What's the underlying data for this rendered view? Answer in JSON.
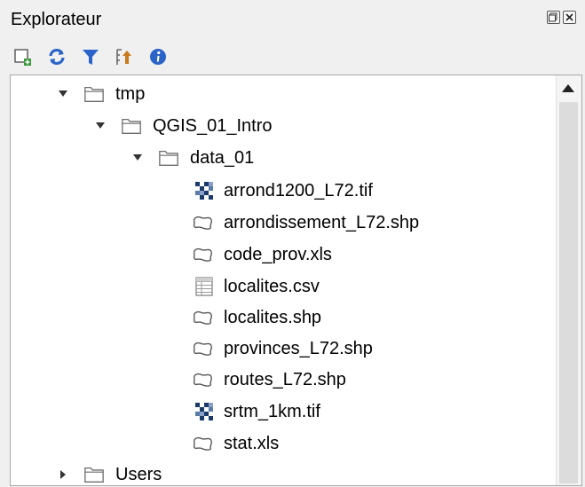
{
  "panel": {
    "title": "Explorateur",
    "dock_buttons": [
      {
        "name": "float-icon"
      },
      {
        "name": "close-icon"
      }
    ]
  },
  "toolbar": {
    "buttons": [
      {
        "name": "add-selected-layers-icon",
        "color": "#3a9a3a"
      },
      {
        "name": "refresh-icon",
        "color": "#2a64c8"
      },
      {
        "name": "filter-icon",
        "color": "#2a64c8"
      },
      {
        "name": "collapse-all-icon",
        "color": "#c87a1a"
      },
      {
        "name": "properties-info-icon",
        "color": "#2a64c8"
      }
    ]
  },
  "tree": {
    "rows": [
      {
        "label": "tmp",
        "icon": "folder-icon",
        "expanded": true,
        "has_arrow": true
      },
      {
        "label": "QGIS_01_Intro",
        "icon": "folder-icon",
        "expanded": true,
        "has_arrow": true
      },
      {
        "label": "data_01",
        "icon": "folder-icon",
        "expanded": true,
        "has_arrow": true
      },
      {
        "label": "arrond1200_L72.tif",
        "icon": "raster-icon",
        "has_arrow": false
      },
      {
        "label": "arrondissement_L72.shp",
        "icon": "vector-polygon-icon",
        "has_arrow": false
      },
      {
        "label": "code_prov.xls",
        "icon": "vector-polygon-icon",
        "has_arrow": false
      },
      {
        "label": "localites.csv",
        "icon": "table-icon",
        "has_arrow": false
      },
      {
        "label": "localites.shp",
        "icon": "vector-polygon-icon",
        "has_arrow": false
      },
      {
        "label": "provinces_L72.shp",
        "icon": "vector-polygon-icon",
        "has_arrow": false
      },
      {
        "label": "routes_L72.shp",
        "icon": "vector-polygon-icon",
        "has_arrow": false
      },
      {
        "label": "srtm_1km.tif",
        "icon": "raster-icon",
        "has_arrow": false
      },
      {
        "label": "stat.xls",
        "icon": "vector-polygon-icon",
        "has_arrow": false
      },
      {
        "label": "Users",
        "icon": "folder-icon",
        "expanded": false,
        "has_arrow": true
      }
    ]
  },
  "colors": {
    "tree_background": "#ffffff",
    "panel_background": "#f0f0f0",
    "raster_dark": "#1a3a6a"
  }
}
